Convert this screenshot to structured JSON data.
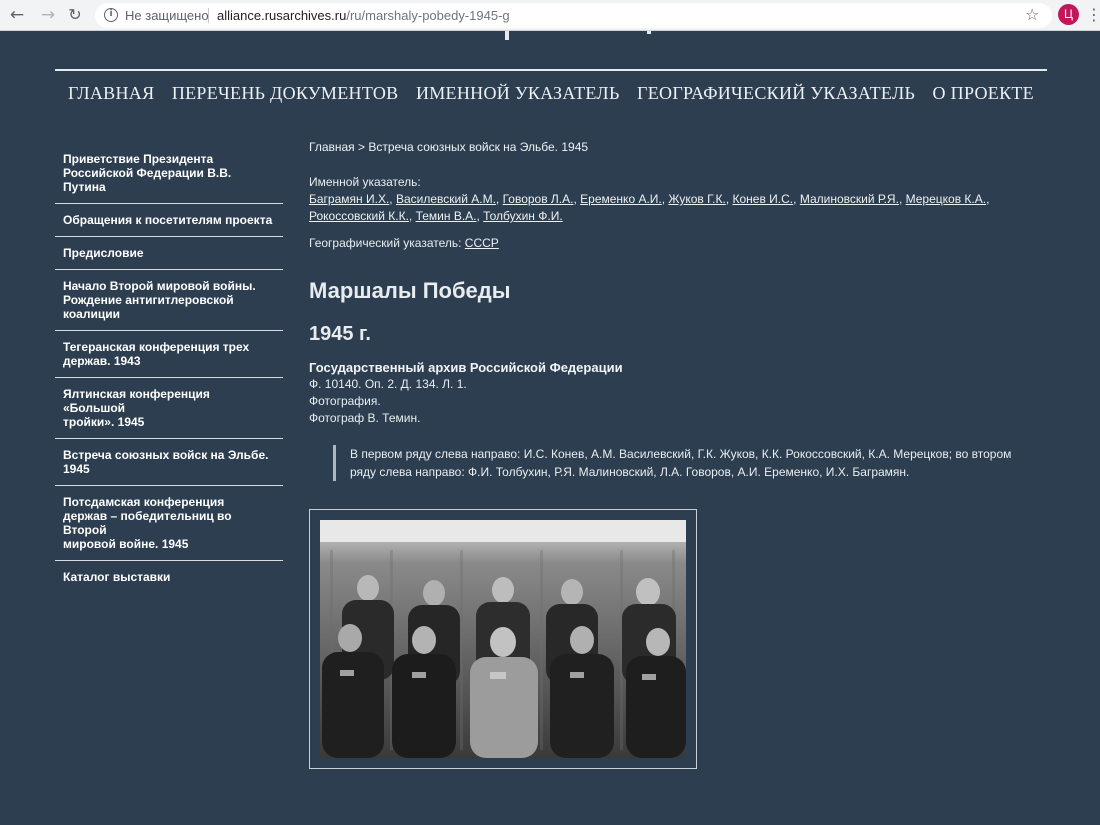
{
  "browser": {
    "security_label": "Не защищено",
    "url_host": "alliance.rusarchives.ru",
    "url_path": "/ru/marshaly-pobedy-1945-g",
    "profile_initial": "Ц"
  },
  "nav": {
    "items": [
      {
        "label": "ГЛАВНАЯ"
      },
      {
        "label": "ПЕРЕЧЕНЬ ДОКУМЕНТОВ"
      },
      {
        "label": "ИМЕННОЙ УКАЗАТЕЛЬ"
      },
      {
        "label": "ГЕОГРАФИЧЕСКИЙ УКАЗАТЕЛЬ"
      },
      {
        "label": "О ПРОЕКТЕ"
      }
    ]
  },
  "sidebar": {
    "items": [
      {
        "lines": [
          "Приветствие Президента",
          "Российской Федерации В.В. Путина"
        ]
      },
      {
        "lines": [
          "Обращения к посетителям проекта"
        ]
      },
      {
        "lines": [
          "Предисловие"
        ]
      },
      {
        "lines": [
          "Начало Второй мировой войны.",
          "Рождение антигитлеровской",
          "коалиции"
        ]
      },
      {
        "lines": [
          "Тегеранская конференция трех",
          "держав. 1943"
        ]
      },
      {
        "lines": [
          "Ялтинская конференция «Большой",
          "тройки». 1945"
        ]
      },
      {
        "lines": [
          "Встреча союзных войск на Эльбе.",
          "1945"
        ]
      },
      {
        "lines": [
          "Потсдамская конференция",
          "держав – победительниц во Второй",
          "мировой войне. 1945"
        ]
      },
      {
        "lines": [
          "Каталог выставки"
        ]
      }
    ]
  },
  "content": {
    "breadcrumb": "Главная > Встреча союзных войск на Эльбе. 1945",
    "index_label": "Именной указатель:",
    "people": [
      "Баграмян И.Х.",
      "Василевский А.М.",
      "Говоров Л.А.",
      "Еременко А.И.",
      "Жуков Г.К.",
      "Конев И.С.",
      "Малиновский Р.Я.",
      "Мерецков К.А.",
      "Рокоссовский К.К.",
      "Темин В.А.",
      "Толбухин Ф.И."
    ],
    "geo_label": "Географический указатель:",
    "geo_link": "СССР",
    "title": "Маршалы Победы",
    "year": "1945 г.",
    "archive": "Государственный архив Российской Федерации",
    "ref": "Ф. 10140. Оп. 2. Д. 134. Л. 1.",
    "kind": "Фотография.",
    "author": "Фотограф В. Темин.",
    "caption": "В первом ряду слева направо: И.С. Конев, А.М. Василевский, Г.К. Жуков, К.К. Рокоссовский, К.А. Мерецков; во втором ряду слева направо: Ф.И. Толбухин, Р.Я. Малиновский, Л.А. Говоров, А.И. Еременко, И.Х. Баграмян."
  }
}
